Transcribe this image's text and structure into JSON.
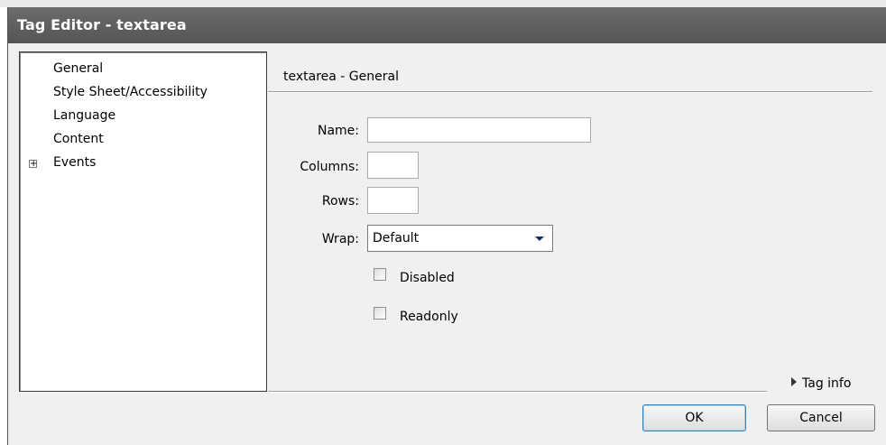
{
  "window": {
    "title": "Tag Editor - textarea"
  },
  "sidebar": {
    "items": [
      {
        "label": "General"
      },
      {
        "label": "Style Sheet/Accessibility"
      },
      {
        "label": "Language"
      },
      {
        "label": "Content"
      },
      {
        "label": "Events",
        "expander": "+"
      }
    ]
  },
  "panel": {
    "header": "textarea - General",
    "fields": {
      "name_label": "Name:",
      "name_value": "",
      "columns_label": "Columns:",
      "columns_value": "",
      "rows_label": "Rows:",
      "rows_value": "",
      "wrap_label": "Wrap:",
      "wrap_value": "Default"
    },
    "checkboxes": {
      "disabled_label": "Disabled",
      "disabled_checked": false,
      "readonly_label": "Readonly",
      "readonly_checked": false
    },
    "tag_info_label": "Tag info"
  },
  "buttons": {
    "ok": "OK",
    "cancel": "Cancel"
  }
}
